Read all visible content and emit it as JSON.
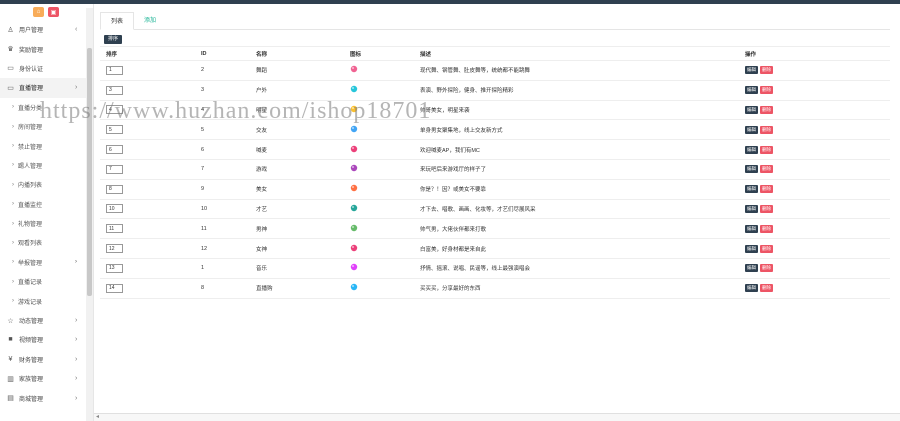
{
  "sidebar": {
    "top_icons": [
      {
        "icon": "home-icon",
        "color": "#f8ac59",
        "glyph": "⌂"
      },
      {
        "icon": "trash-icon",
        "color": "#ed5565",
        "glyph": "▣"
      }
    ],
    "items": [
      {
        "label": "用户管理",
        "icon": "user-icon",
        "glyph": "♙",
        "arrow": "‹",
        "type": "item"
      },
      {
        "label": "奖励管理",
        "icon": "trophy-icon",
        "glyph": "♛",
        "type": "item"
      },
      {
        "label": "身份认证",
        "icon": "id-card-icon",
        "glyph": "▭",
        "type": "item"
      },
      {
        "label": "直播管理",
        "icon": "monitor-icon",
        "glyph": "▭",
        "arrow": "›",
        "type": "item",
        "active": true
      },
      {
        "label": "直播分类",
        "type": "sub"
      },
      {
        "label": "房间管理",
        "type": "sub"
      },
      {
        "label": "禁止管理",
        "type": "sub"
      },
      {
        "label": "踢人管理",
        "type": "sub"
      },
      {
        "label": "内播列表",
        "type": "sub"
      },
      {
        "label": "直播监控",
        "type": "sub"
      },
      {
        "label": "礼物管理",
        "type": "sub"
      },
      {
        "label": "观看列表",
        "type": "sub"
      },
      {
        "label": "举报管理",
        "type": "sub",
        "arrow": "›"
      },
      {
        "label": "直播记录",
        "type": "sub"
      },
      {
        "label": "游戏记录",
        "type": "sub"
      },
      {
        "label": "动态管理",
        "icon": "star-icon",
        "glyph": "☆",
        "arrow": "›",
        "type": "item"
      },
      {
        "label": "视频管理",
        "icon": "video-icon",
        "glyph": "■",
        "arrow": "›",
        "type": "item"
      },
      {
        "label": "财务管理",
        "icon": "yen-icon",
        "glyph": "¥",
        "arrow": "›",
        "type": "item"
      },
      {
        "label": "家族管理",
        "icon": "bank-icon",
        "glyph": "▥",
        "arrow": "›",
        "type": "item"
      },
      {
        "label": "商城管理",
        "icon": "cart-icon",
        "glyph": "▤",
        "arrow": "›",
        "type": "item"
      }
    ]
  },
  "tabs": [
    {
      "label": "列表",
      "active": true
    },
    {
      "label": "添加",
      "active": false
    }
  ],
  "sort_button": "排序",
  "table": {
    "headers": [
      "排序",
      "ID",
      "名称",
      "图标",
      "描述",
      "操作"
    ],
    "rows": [
      {
        "sort": "1",
        "id": "2",
        "name": "舞蹈",
        "icon_color": "#f06292",
        "desc": "现代舞、钢管舞、肚皮舞等，统统都不能跳舞"
      },
      {
        "sort": "3",
        "id": "3",
        "name": "户外",
        "icon_color": "#26c6da",
        "desc": "表演、野外探险，健身、推开探险精彩"
      },
      {
        "sort": "4",
        "id": "4",
        "name": "明星",
        "icon_color": "#fbc02d",
        "desc": "帅哥美女，明星来袭"
      },
      {
        "sort": "5",
        "id": "5",
        "name": "交友",
        "icon_color": "#42a5f5",
        "desc": "单身男女聚集地，线上交友新方式"
      },
      {
        "sort": "6",
        "id": "6",
        "name": "喊麦",
        "icon_color": "#ec407a",
        "desc": "欢迎喊麦AP，我们有MC"
      },
      {
        "sort": "7",
        "id": "7",
        "name": "游戏",
        "icon_color": "#ab47bc",
        "desc": "来玩吧后来游戏厅的样子了"
      },
      {
        "sort": "8",
        "id": "9",
        "name": "美女",
        "icon_color": "#ff7043",
        "desc": "你是？！因？或美女不要靠"
      },
      {
        "sort": "10",
        "id": "10",
        "name": "才艺",
        "icon_color": "#26a69a",
        "desc": "才下去、唱歌、画画、化妆等，才艺们尽展风采"
      },
      {
        "sort": "11",
        "id": "11",
        "name": "男神",
        "icon_color": "#66bb6a",
        "desc": "帅气男，大佬伙伴都来打歌"
      },
      {
        "sort": "12",
        "id": "12",
        "name": "女神",
        "icon_color": "#ec407a",
        "desc": "白富美，好身材都是来自此"
      },
      {
        "sort": "13",
        "id": "1",
        "name": "音乐",
        "icon_color": "#e040fb",
        "desc": "抒情、摇滚、说唱、民谣等，线上最强演唱会"
      },
      {
        "sort": "14",
        "id": "8",
        "name": "直播购",
        "icon_color": "#29b6f6",
        "desc": "买买买，分享最好的东西"
      }
    ],
    "edit_label": "编辑",
    "delete_label": "删除"
  },
  "watermark": "https://www.huzhan.com/ishop18701",
  "colors": {
    "topbar": "#2f4050",
    "accent": "#1ab394",
    "edit": "#2f4050",
    "delete": "#ed5565"
  }
}
